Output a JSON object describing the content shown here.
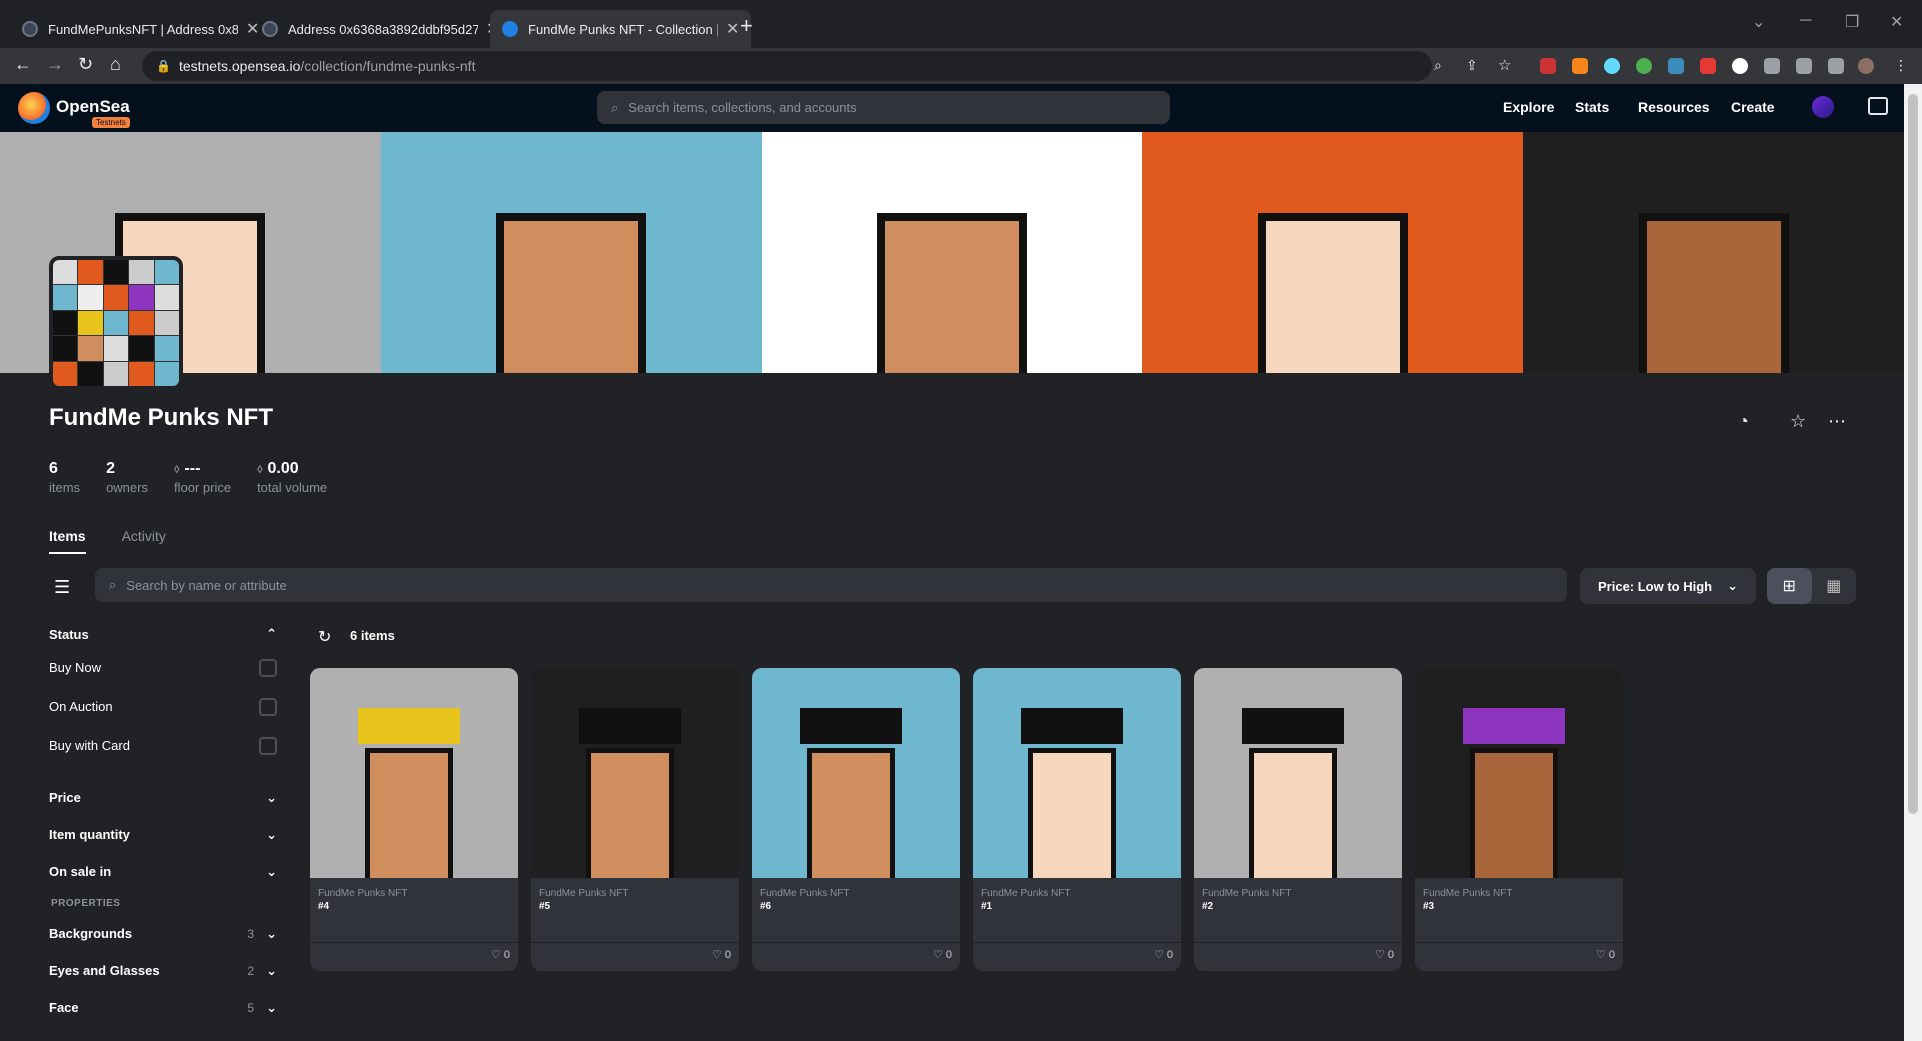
{
  "browser": {
    "tabs": [
      {
        "title": "FundMePunksNFT | Address 0x8..."
      },
      {
        "title": "Address 0x6368a3892ddbf95d27..."
      },
      {
        "title": "FundMe Punks NFT - Collection |"
      }
    ],
    "url_host": "testnets.opensea.io",
    "url_path": "/collection/fundme-punks-nft"
  },
  "header": {
    "brand": "OpenSea",
    "badge": "Testnets",
    "search_placeholder": "Search items, collections, and accounts",
    "nav": [
      "Explore",
      "Stats",
      "Resources",
      "Create"
    ]
  },
  "collection": {
    "title": "FundMe Punks NFT",
    "stats": [
      {
        "value": "6",
        "label": "items"
      },
      {
        "value": "2",
        "label": "owners"
      },
      {
        "value": "---",
        "label": "floor price"
      },
      {
        "value": "0.00",
        "label": "total volume"
      }
    ],
    "tabs": [
      "Items",
      "Activity"
    ]
  },
  "controls": {
    "search_placeholder": "Search by name or attribute",
    "sort_label": "Price: Low to High",
    "item_count": "6 items"
  },
  "sidebar": {
    "status_label": "Status",
    "status_options": [
      "Buy Now",
      "On Auction",
      "Buy with Card"
    ],
    "sections": [
      "Price",
      "Item quantity",
      "On sale in"
    ],
    "properties_label": "PROPERTIES",
    "properties": [
      {
        "name": "Backgrounds",
        "count": "3"
      },
      {
        "name": "Eyes and Glasses",
        "count": "2"
      },
      {
        "name": "Face",
        "count": "5"
      }
    ]
  },
  "items": [
    {
      "collection": "FundMe Punks NFT",
      "token": "#4",
      "likes": "0",
      "bg": "#b0b0b0",
      "skin": "#d08e5e",
      "hat": "#e6c41b"
    },
    {
      "collection": "FundMe Punks NFT",
      "token": "#5",
      "likes": "0",
      "bg": "#1f1f1f",
      "skin": "#d08e5e",
      "hat": "#111111"
    },
    {
      "collection": "FundMe Punks NFT",
      "token": "#6",
      "likes": "0",
      "bg": "#6fb6cf",
      "skin": "#d08e5e",
      "hat": "#111111"
    },
    {
      "collection": "FundMe Punks NFT",
      "token": "#1",
      "likes": "0",
      "bg": "#6fb6cf",
      "skin": "#f6d7be",
      "hat": "#111111"
    },
    {
      "collection": "FundMe Punks NFT",
      "token": "#2",
      "likes": "0",
      "bg": "#b0b0b0",
      "skin": "#f6d7be",
      "hat": "#111111"
    },
    {
      "collection": "FundMe Punks NFT",
      "token": "#3",
      "likes": "0",
      "bg": "#1f1f1f",
      "skin": "#a8663a",
      "hat": "#8e35c0"
    }
  ],
  "banner_tiles": [
    {
      "bg": "#b0b0b0",
      "skin": "#f6d7be"
    },
    {
      "bg": "#6fb6cf",
      "skin": "#d08e5e"
    },
    {
      "bg": "#ffffff",
      "skin": "#d08e5e"
    },
    {
      "bg": "#e05a1e",
      "skin": "#f6d7be"
    },
    {
      "bg": "#1f1f1f",
      "skin": "#a8663a"
    }
  ]
}
